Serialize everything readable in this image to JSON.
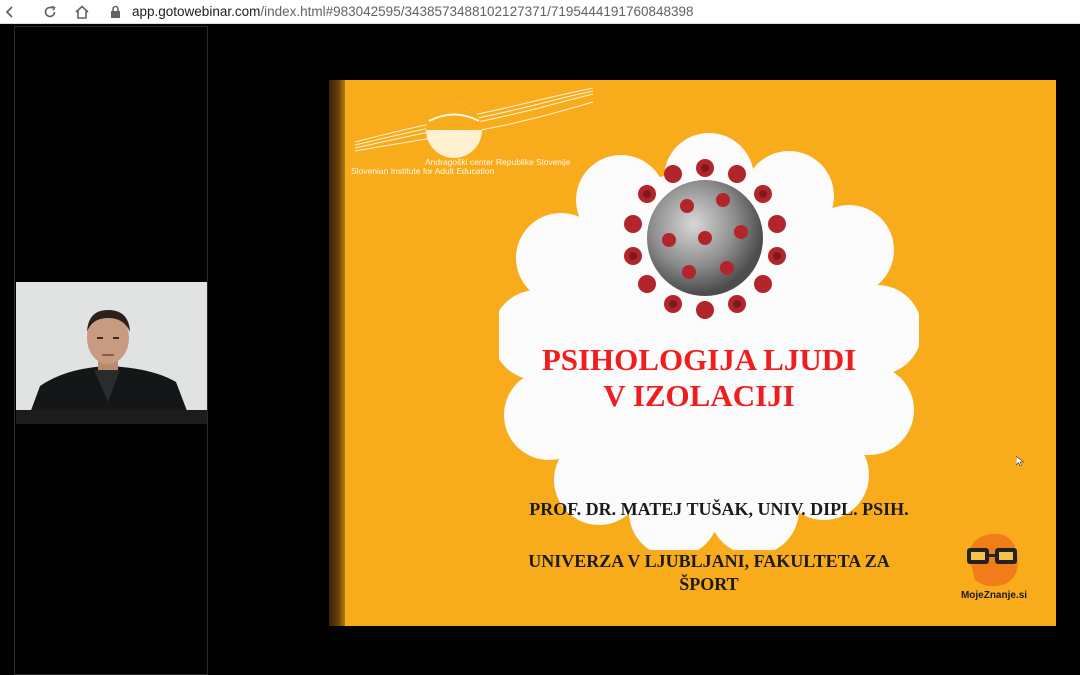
{
  "browser": {
    "url_host": "app.gotowebinar.com",
    "url_path": "/index.html#983042595/3438573488102127371/7195444191760848398",
    "icons": [
      "back-icon",
      "reload-icon",
      "home-icon",
      "lock-icon"
    ]
  },
  "slide": {
    "logo_line1": "Andragoški center Republike Slovenije",
    "logo_line2": "Slovenian Institute for Adult Education",
    "title_line1": "PSIHOLOGIJA LJUDI",
    "title_line2": "V IZOLACIJI",
    "author": "PROF. DR. MATEJ TUŠAK, UNIV. DIPL. PSIH.",
    "university_line1": "UNIVERZA V LJUBLJANI, FAKULTETA ZA",
    "university_line2": "ŠPORT",
    "brand": "MojeZnanje.si",
    "colors": {
      "background": "#f8ac1b",
      "title": "#ef1d1d",
      "virus": "#b2262b"
    }
  }
}
